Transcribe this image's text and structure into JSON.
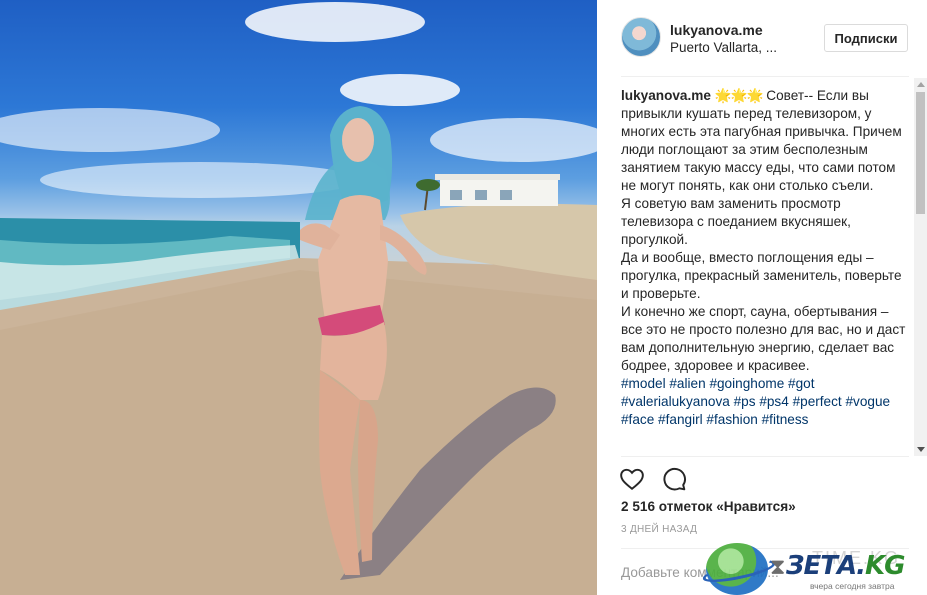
{
  "post": {
    "username": "lukyanova.me",
    "location": "Puerto Vallarta, Jalisco",
    "follow_label": "Подписки"
  },
  "caption": {
    "username": "lukyanova.me",
    "emoji": "🌟🌟🌟",
    "lines": [
      "Совет-- Если вы привыкли кушать перед телевизором, у многих есть эта пагубная привычка. Причем люди поглощают за этим бесполезным занятием такую массу еды, что сами потом не могут понять, как они столько съели.",
      "Я советую вам заменить просмотр телевизора с поеданием вкусняшек, прогулкой.",
      "Да и вообще, вместо поглощения еды – прогулка, прекрасный заменитель, поверьте и проверьте.",
      "И конечно же спорт, сауна, обертывания – все это не просто полезно для вас, но и даст вам дополнительную энергию, сделает вас бодрее, здоровее и красивее."
    ],
    "hashtags": [
      "#model",
      "#alien",
      "#goinghome",
      "#got",
      "#valerialukyanova",
      "#ps",
      "#ps4",
      "#perfect",
      "#vogue",
      "#face",
      "#fangirl",
      "#fashion",
      "#fitness"
    ]
  },
  "actions": {
    "like_icon": "heart-icon",
    "comment_icon": "comment-icon"
  },
  "likes_text": "2 516 отметок «Нравится»",
  "timestamp": "3 ДНЕЙ НАЗАД",
  "comment": {
    "placeholder": "Добавьте комментарий..."
  },
  "watermark": {
    "brand_main": "ЗЕТА.",
    "brand_tld": "KG",
    "ghost": "TIME.KG",
    "tagline": "вчера сегодня завтра"
  },
  "colors": {
    "hashtag": "#003569",
    "text": "#262626",
    "muted": "#999999",
    "border": "#dbdbdb"
  }
}
